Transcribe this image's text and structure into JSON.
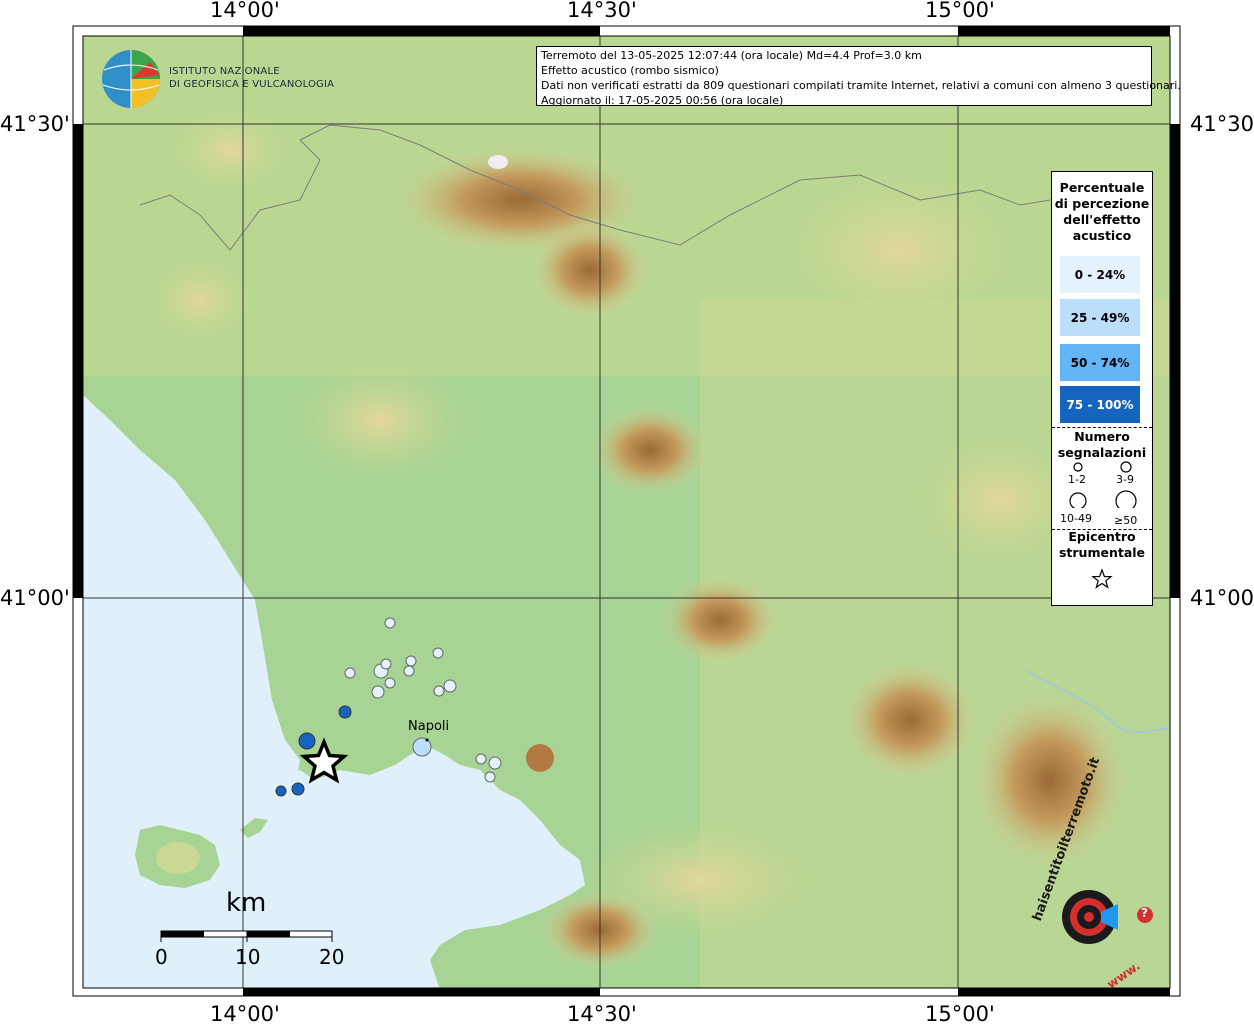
{
  "coords": {
    "top": [
      "14°00'",
      "14°30'",
      "15°00'"
    ],
    "bottom": [
      "14°00'",
      "14°30'",
      "15°00'"
    ],
    "left": [
      "41°30'",
      "41°00'"
    ],
    "right": [
      "41°30'",
      "41°00'"
    ]
  },
  "logo": {
    "line1": "ISTITUTO NAZIONALE",
    "line2": "DI GEOFISICA E VULCANOLOGIA"
  },
  "info": {
    "line1": "Terremoto del 13-05-2025 12:07:44 (ora locale) Md=4.4 Prof=3.0 km",
    "line2": "Effetto acustico (rombo sismico)",
    "line3": "Dati non verificati estratti da 809 questionari compilati tramite Internet, relativi a comuni con almeno 3 questionari.",
    "line4": "Aggiornato il: 17-05-2025 00:56 (ora locale)"
  },
  "legend": {
    "title_lines": [
      "Percentuale",
      "di percezione",
      "dell'effetto",
      "acustico"
    ],
    "classes": [
      {
        "label": "0 - 24%",
        "color": "#e3f2fd",
        "text_color": "#000000"
      },
      {
        "label": "25 - 49%",
        "color": "#bbdefb",
        "text_color": "#000000"
      },
      {
        "label": "50 - 74%",
        "color": "#64b5f6",
        "text_color": "#000000"
      },
      {
        "label": "75 - 100%",
        "color": "#1565c0",
        "text_color": "#ffffff"
      }
    ],
    "count_title_lines": [
      "Numero",
      "segnalazioni"
    ],
    "count_labels": [
      "1-2",
      "3-9",
      "10-49",
      "≥50"
    ],
    "epicenter_title_lines": [
      "Epicentro",
      "strumentale"
    ]
  },
  "city": "Napoli",
  "scale": {
    "title": "km",
    "labels": [
      "0",
      "10",
      "20"
    ]
  },
  "brand": {
    "text": "haisentitoilterremoto.it",
    "www": "www.",
    "question": "?"
  },
  "colors": {
    "sea": "#dff0fb",
    "land": "#9fcf8f",
    "hill": "#c8d98e",
    "mountain": "#b8894e",
    "peak": "#8d5a2c"
  }
}
